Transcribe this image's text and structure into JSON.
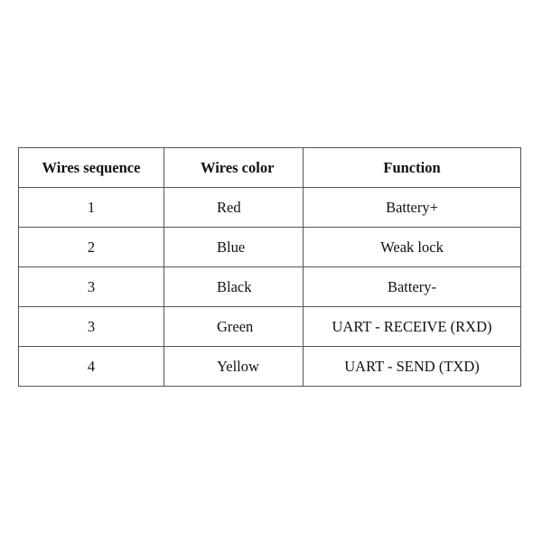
{
  "table": {
    "headers": [
      "Wires sequence",
      "Wires color",
      "Function"
    ],
    "rows": [
      {
        "sequence": "1",
        "color": "Red",
        "function": "Battery+"
      },
      {
        "sequence": "2",
        "color": "Blue",
        "function": "Weak lock"
      },
      {
        "sequence": "3",
        "color": "Black",
        "function": "Battery-"
      },
      {
        "sequence": "3",
        "color": "Green",
        "function": "UART - RECEIVE (RXD)"
      },
      {
        "sequence": "4",
        "color": "Yellow",
        "function": "UART - SEND (TXD)"
      }
    ]
  }
}
